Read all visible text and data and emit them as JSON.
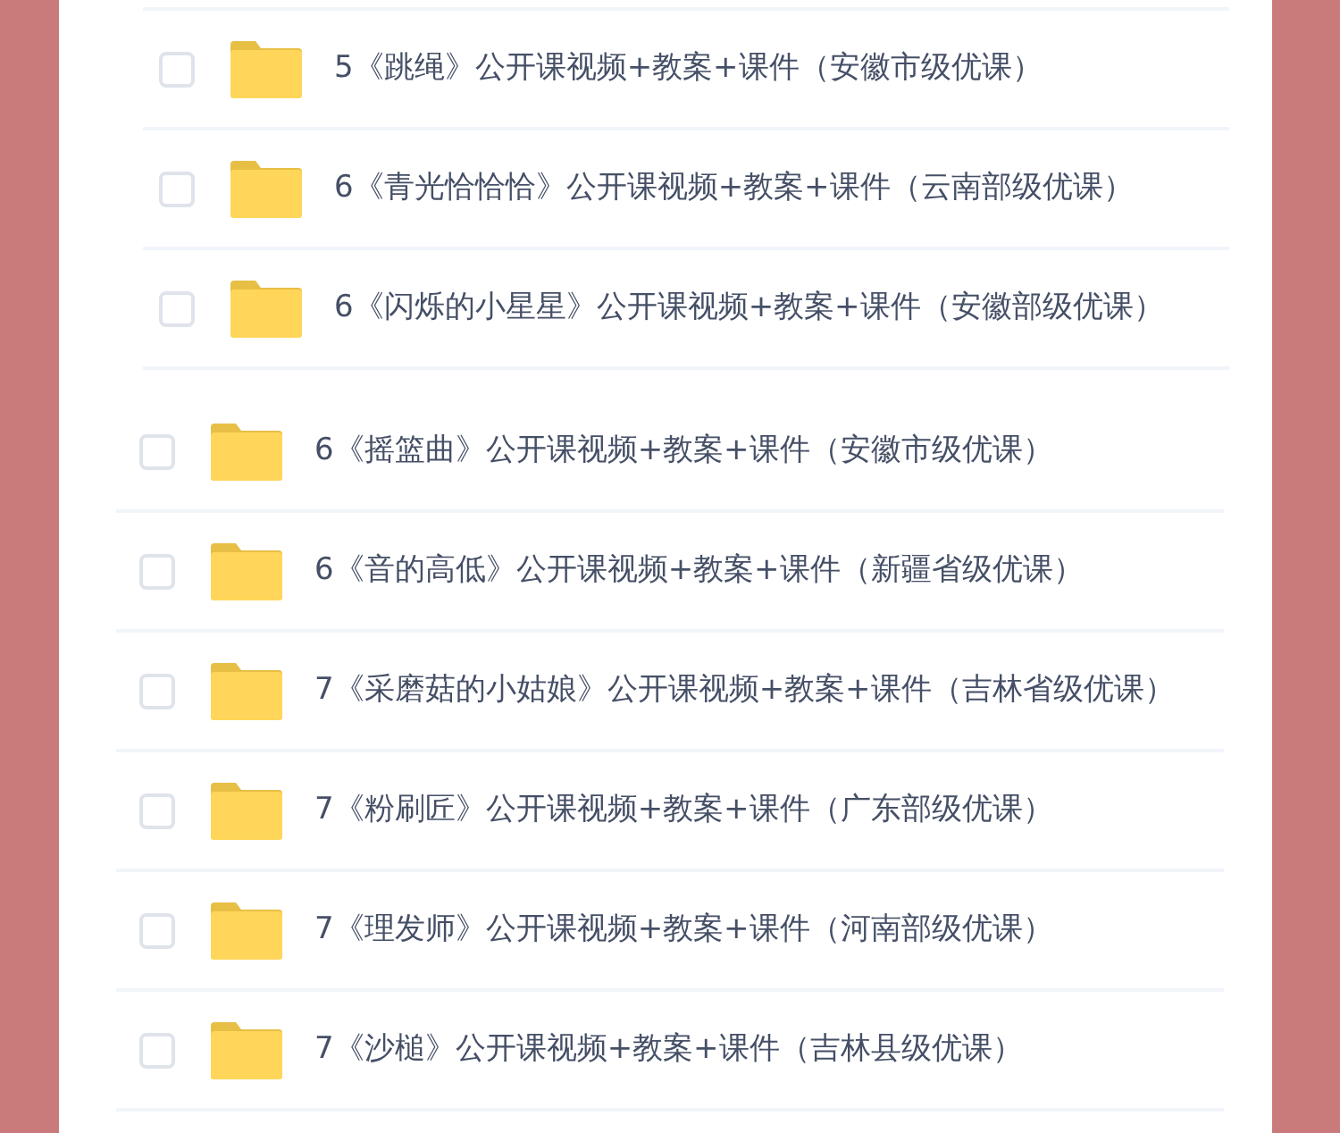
{
  "groups": [
    {
      "rows": [
        {
          "name": "5《跳绳》公开课视频+教案+课件（安徽市级优课）",
          "checked": false
        },
        {
          "name": "6《青光恰恰恰》公开课视频+教案+课件（云南部级优课）",
          "checked": false
        },
        {
          "name": "6《闪烁的小星星》公开课视频+教案+课件（安徽部级优课）",
          "checked": false
        }
      ]
    },
    {
      "rows": [
        {
          "name": "6《摇篮曲》公开课视频+教案+课件（安徽市级优课）",
          "checked": false
        },
        {
          "name": "6《音的高低》公开课视频+教案+课件（新疆省级优课）",
          "checked": false
        },
        {
          "name": "7《采磨菇的小姑娘》公开课视频+教案+课件（吉林省级优课）",
          "checked": false
        },
        {
          "name": "7《粉刷匠》公开课视频+教案+课件（广东部级优课）",
          "checked": false
        },
        {
          "name": "7《理发师》公开课视频+教案+课件（河南部级优课）",
          "checked": false
        },
        {
          "name": "7《沙槌》公开课视频+教案+课件（吉林县级优课）",
          "checked": false
        }
      ]
    }
  ]
}
